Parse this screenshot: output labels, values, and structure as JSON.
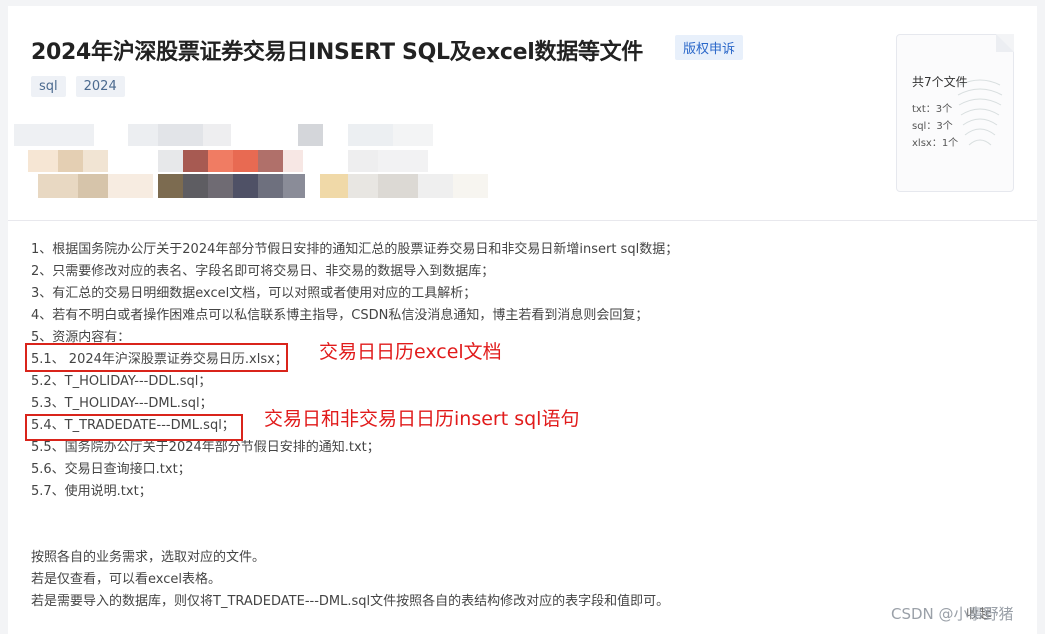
{
  "resource": {
    "title": "2024年沪深股票证券交易日INSERT SQL及excel数据等文件",
    "report_label": "版权申诉",
    "tags": [
      "sql",
      "2024"
    ]
  },
  "file_summary": {
    "count_text": "共7个文件",
    "types": [
      "txt：3个",
      "sql：3个",
      "xlsx：1个"
    ]
  },
  "description": {
    "lines": [
      "1、根据国务院办公厅关于2024年部分节假日安排的通知汇总的股票证券交易日和非交易日新增insert sql数据；",
      "2、只需要修改对应的表名、字段名即可将交易日、非交易的数据导入到数据库；",
      "3、有汇总的交易日明细数据excel文档，可以对照或者使用对应的工具解析；",
      "4、若有不明白或者操作困难点可以私信联系博主指导，CSDN私信没消息通知，博主若看到消息则会回复；",
      "5、资源内容有：",
      "5.1、 2024年沪深股票证券交易日历.xlsx；",
      "5.2、T_HOLIDAY---DDL.sql；",
      "5.3、T_HOLIDAY---DML.sql；",
      "5.4、T_TRADEDATE---DML.sql；",
      "5.5、国务院办公厅关于2024年部分节假日安排的通知.txt；",
      "5.6、交易日查询接口.txt；",
      "5.7、使用说明.txt；"
    ],
    "footer_lines": [
      "按照各自的业务需求，选取对应的文件。",
      "若是仅查看，可以看excel表格。",
      "若是需要导入的数据库，则仅将T_TRADEDATE---DML.sql文件按照各自的表结构修改对应的表字段和值即可。"
    ]
  },
  "annotations": {
    "excel_note": "交易日日历excel文档",
    "sql_note": "交易日和非交易日日历insert sql语句",
    "color": "#e11b1b"
  },
  "collapse_label": "收起",
  "watermark": "CSDN @小事野猪"
}
